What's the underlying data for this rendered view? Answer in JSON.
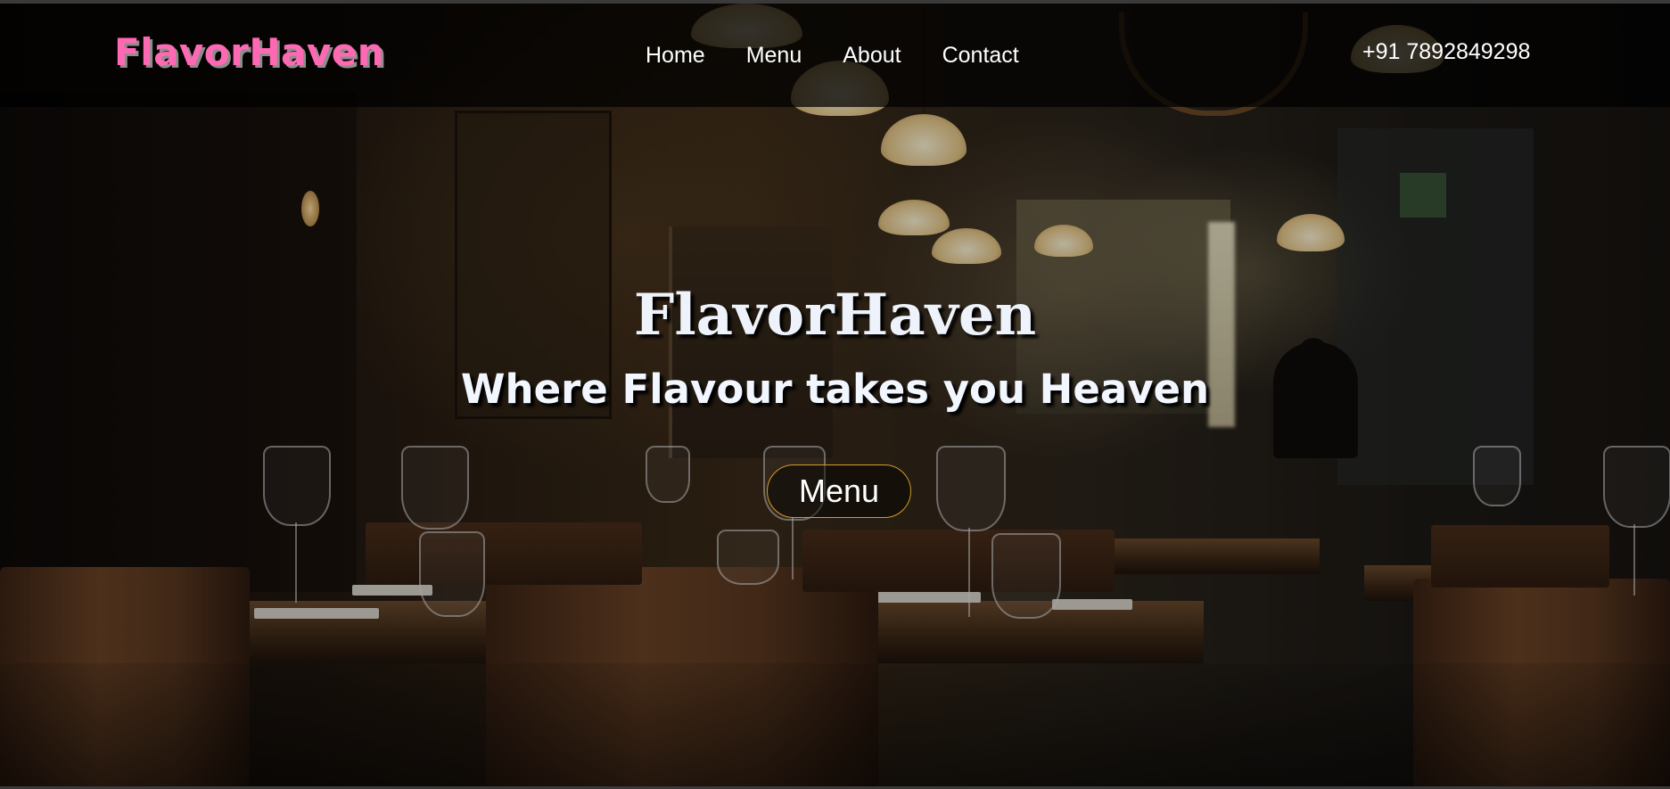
{
  "brand": {
    "logo_text": "FlavorHaven",
    "logo_color": "#ff69b4"
  },
  "nav": {
    "links": [
      {
        "label": "Home"
      },
      {
        "label": "Menu"
      },
      {
        "label": "About"
      },
      {
        "label": "Contact"
      }
    ],
    "phone": "+91 7892849298"
  },
  "hero": {
    "title": "FlavorHaven",
    "subtitle": "Where Flavour takes you Heaven",
    "button_label": "Menu",
    "button_border_color": "#d89a2a",
    "background_image": "restaurant-interior-photo"
  }
}
